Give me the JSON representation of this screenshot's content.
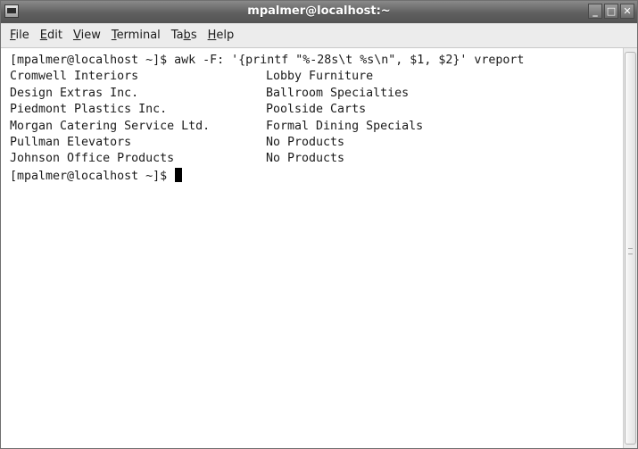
{
  "window": {
    "title": "mpalmer@localhost:~",
    "buttons": {
      "minimize": "_",
      "maximize": "□",
      "close": "✕"
    }
  },
  "menubar": {
    "items": [
      {
        "label_pre": "",
        "label_u": "F",
        "label_post": "ile"
      },
      {
        "label_pre": "",
        "label_u": "E",
        "label_post": "dit"
      },
      {
        "label_pre": "",
        "label_u": "V",
        "label_post": "iew"
      },
      {
        "label_pre": "",
        "label_u": "T",
        "label_post": "erminal"
      },
      {
        "label_pre": "Ta",
        "label_u": "b",
        "label_post": "s"
      },
      {
        "label_pre": "",
        "label_u": "H",
        "label_post": "elp"
      }
    ]
  },
  "terminal": {
    "command_line": "[mpalmer@localhost ~]$ awk -F: '{printf \"%-28s\\t %s\\n\", $1, $2}' vreport",
    "rows": [
      {
        "name": "Cromwell Interiors",
        "product": "Lobby Furniture"
      },
      {
        "name": "Design Extras Inc.",
        "product": "Ballroom Specialties"
      },
      {
        "name": "Piedmont Plastics Inc.",
        "product": "Poolside Carts"
      },
      {
        "name": "Morgan Catering Service Ltd.",
        "product": "Formal Dining Specials"
      },
      {
        "name": "Pullman Elevators",
        "product": "No Products"
      },
      {
        "name": "Johnson Office Products",
        "product": "No Products"
      }
    ],
    "prompt": "[mpalmer@localhost ~]$ "
  }
}
